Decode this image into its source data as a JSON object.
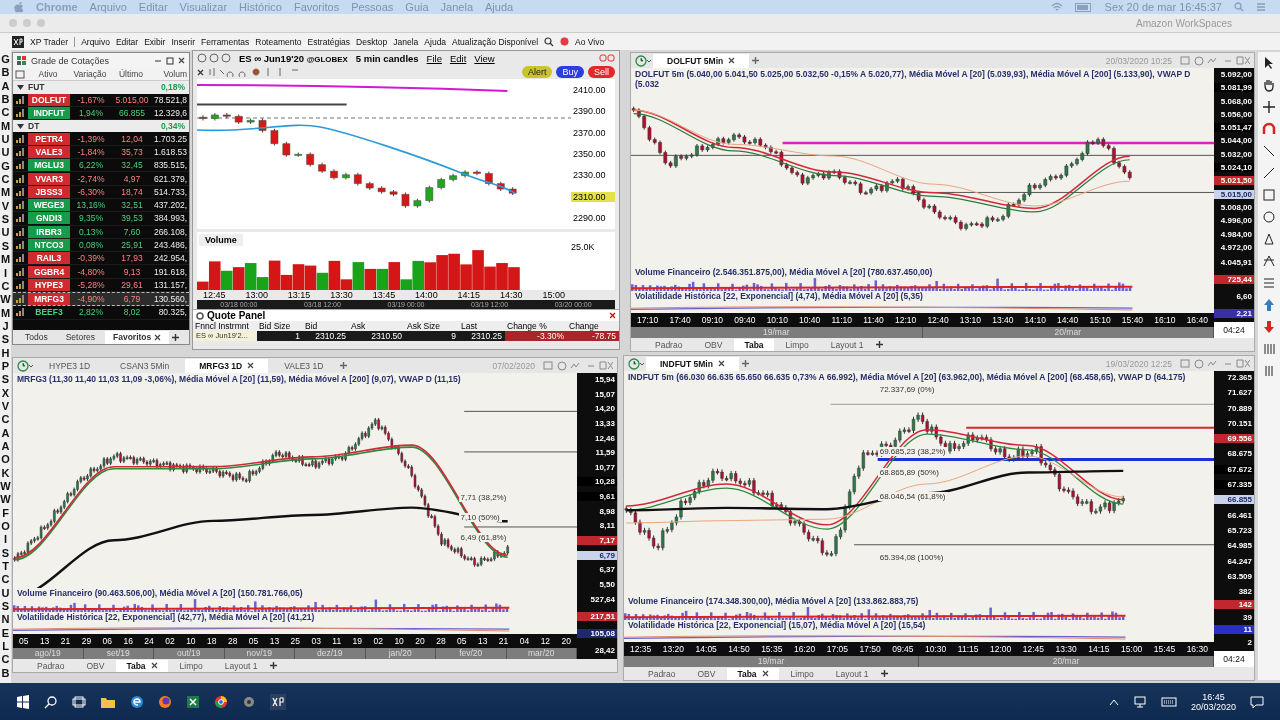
{
  "edge_letters": [
    "G",
    "B",
    "A",
    "B",
    "C",
    "M",
    "U",
    "U",
    "G",
    "C",
    "M",
    "V",
    "S",
    "U",
    "S",
    "M",
    "I",
    "C",
    "W",
    "M",
    "J",
    "S",
    "H",
    "P",
    "S",
    "X",
    "V",
    "C",
    "A",
    "A",
    "O",
    "K",
    "W",
    "W",
    "F",
    "O",
    "I",
    "S",
    "T",
    "C",
    "U",
    "S",
    "N",
    "E",
    "L",
    "C",
    "B"
  ],
  "mac_menubar": {
    "app": "Chrome",
    "menus": [
      "Arquivo",
      "Editar",
      "Visualizar",
      "Histórico",
      "Favoritos",
      "Pessoas",
      "Guia",
      "Janela",
      "Ajuda"
    ],
    "clock": "Sex 20 de mar  16:45:37"
  },
  "workspace_window": {
    "title": "Amazon WorkSpaces"
  },
  "xp_menubar": {
    "app": "XP Trader",
    "menus": [
      "Arquivo",
      "Editar",
      "Exibir",
      "Inserir",
      "Ferramentas",
      "Roteamento",
      "Estratégias",
      "Desktop",
      "Janela",
      "Ajuda",
      "Atualização Disponível"
    ],
    "live": "Ao Vivo"
  },
  "quote_grid": {
    "title": "Grade de Cotações",
    "columns": [
      "Ativo",
      "Variação",
      "Último",
      "Volum"
    ],
    "groups": [
      {
        "name": "FUT",
        "change": "0,18%",
        "expanded": true,
        "rows": [
          {
            "symbol": "DOLFUT",
            "change": "-1,67%",
            "last": "5.015,00",
            "volume": "78.521,8",
            "up": false,
            "badge": true,
            "selected": false
          },
          {
            "symbol": "INDFUT",
            "change": "1,94%",
            "last": "66.855",
            "volume": "12.329,6",
            "up": true,
            "badge": true,
            "selected": false
          }
        ]
      },
      {
        "name": "DT",
        "change": "0,34%",
        "expanded": true,
        "rows": [
          {
            "symbol": "PETR4",
            "change": "-1,39%",
            "last": "12,04",
            "volume": "1.703.25",
            "up": false,
            "badge": true,
            "selected": false
          },
          {
            "symbol": "VALE3",
            "change": "-1,84%",
            "last": "35,73",
            "volume": "1.618.53",
            "up": false,
            "badge": true,
            "selected": false
          },
          {
            "symbol": "MGLU3",
            "change": "6,22%",
            "last": "32,45",
            "volume": "835.515,",
            "up": true,
            "badge": true,
            "selected": false
          },
          {
            "symbol": "VVAR3",
            "change": "-2,74%",
            "last": "4,97",
            "volume": "621.379,",
            "up": false,
            "badge": true,
            "selected": false
          },
          {
            "symbol": "JBSS3",
            "change": "-6,30%",
            "last": "18,74",
            "volume": "514.733,",
            "up": false,
            "badge": true,
            "selected": false
          },
          {
            "symbol": "WEGE3",
            "change": "13,16%",
            "last": "32,51",
            "volume": "437.202,",
            "up": true,
            "badge": true,
            "selected": false
          },
          {
            "symbol": "GNDI3",
            "change": "9,35%",
            "last": "39,53",
            "volume": "384.993,",
            "up": true,
            "badge": true,
            "selected": false
          },
          {
            "symbol": "IRBR3",
            "change": "0,13%",
            "last": "7,60",
            "volume": "266.108,",
            "up": true,
            "badge": true,
            "selected": false
          },
          {
            "symbol": "NTCO3",
            "change": "0,08%",
            "last": "25,91",
            "volume": "243.486,",
            "up": true,
            "badge": true,
            "selected": false
          },
          {
            "symbol": "RAIL3",
            "change": "-0,39%",
            "last": "17,93",
            "volume": "242.954,",
            "up": false,
            "badge": true,
            "selected": false
          },
          {
            "symbol": "GGBR4",
            "change": "-4,80%",
            "last": "9,13",
            "volume": "191.618,",
            "up": false,
            "badge": true,
            "selected": false
          },
          {
            "symbol": "HYPE3",
            "change": "-5,28%",
            "last": "29,61",
            "volume": "131.157,",
            "up": false,
            "badge": true,
            "selected": false
          },
          {
            "symbol": "MRFG3",
            "change": "-4,90%",
            "last": "6,79",
            "volume": "130.560,",
            "up": false,
            "badge": true,
            "selected": true
          },
          {
            "symbol": "BEEF3",
            "change": "2,82%",
            "last": "8,02",
            "volume": "80.325,",
            "up": true,
            "badge": false,
            "selected": false
          }
        ]
      }
    ],
    "tabs": [
      {
        "label": "Todos",
        "selected": false,
        "closable": false
      },
      {
        "label": "Setores",
        "selected": false,
        "closable": false
      },
      {
        "label": "Favoritos",
        "selected": true,
        "closable": true
      }
    ]
  },
  "es_chart": {
    "symbol": "ES ∞ Jun19'20",
    "exchange": "@GLOBEX",
    "interval": "5 min candles",
    "menus": [
      "File",
      "Edit",
      "View"
    ],
    "buttons": [
      {
        "label": "Alert",
        "kind": "alert"
      },
      {
        "label": "Buy",
        "kind": "buy"
      },
      {
        "label": "Sell",
        "kind": "sell"
      }
    ],
    "price_axis": [
      {
        "label": "2410.00"
      },
      {
        "label": "2390.00"
      },
      {
        "label": "2370.00"
      },
      {
        "label": "2350.00"
      },
      {
        "label": "2330.00"
      },
      {
        "label": "2310.00",
        "color": "#e4e24a"
      },
      {
        "label": "2290.00"
      }
    ],
    "volume_title": "Volume",
    "volume_axis": "25.0K",
    "time_axis": [
      "12:45",
      "13:00",
      "13:15",
      "13:30",
      "13:45",
      "14:00",
      "14:15",
      "14:30",
      "15:00"
    ],
    "scroll_dates": [
      "03/18 00:00",
      "03/18 12:00",
      "03/19 00:00",
      "03/19 12:00",
      "03/20 00:00"
    ]
  },
  "quote_panel": {
    "title": "Quote Panel",
    "columns": [
      "Fnncl Instrmnt",
      "Bid Size",
      "Bid",
      "Ask",
      "Ask Size",
      "Last",
      "Change %",
      "Change"
    ],
    "row": [
      "ES ∞ Jun19'2...",
      "1",
      "2310.25",
      "2310.50",
      "9",
      "2310.25",
      "-3.30%",
      "-78.75"
    ]
  },
  "charts": [
    {
      "tabs": [
        {
          "label": "DOLFUT 5Min",
          "selected": true,
          "closable": true
        }
      ],
      "date": "20/03/2020 10:25",
      "legend": "DOLFUT 5m (5.040,00  5.041,50  5.025,00  5.032,50  -0,15%  A 5.020,77), Média Móvel A [20] (5.039,93), Média Móvel A [200] (5.133,90), VWAP D (5.032",
      "axis": [
        {
          "label": "5.092,00"
        },
        {
          "label": "5.081,99",
          "color": "#000000"
        },
        {
          "label": "5.068,00"
        },
        {
          "label": "5.056,00"
        },
        {
          "label": "5.051,47",
          "color": "#000000"
        },
        {
          "label": "5.044,00"
        },
        {
          "label": "5.032,00"
        },
        {
          "label": "5.024,10",
          "color": "#000000"
        },
        {
          "label": "5.021,50",
          "color": "#c0282d"
        },
        {
          "label": "5.015,00",
          "color": "#c9d3ea"
        },
        {
          "label": "5.008,00"
        },
        {
          "label": "4.996,00"
        },
        {
          "label": "4.984,00"
        },
        {
          "label": "4.972,00"
        }
      ],
      "lower_axis": [
        {
          "label": "4.045,91"
        },
        {
          "label": "725,44",
          "color": "#c0282d"
        },
        {
          "label": "6,60"
        },
        {
          "label": "2,21",
          "color": "#3a2fa8"
        }
      ],
      "volume_legend": "Volume Financeiro (2.546.351.875,00), Média Móvel A [20] (780.637.450,00)",
      "volatility_legend": "Volatilidade Histórica [22, Exponencial] (4,74), Média Móvel A [20] (5,35)",
      "time_axis": [
        "17:10",
        "17:40",
        "09:10",
        "09:40",
        "10:10",
        "10:40",
        "11:10",
        "11:40",
        "12:10",
        "12:40",
        "13:10",
        "13:40",
        "14:10",
        "14:40",
        "15:10",
        "15:40",
        "16:10",
        "16:40"
      ],
      "date_band": [
        "19/mar",
        "20/mar"
      ],
      "clock": "04:24",
      "bottom_tabs": [
        {
          "label": "Padrao",
          "selected": false,
          "closable": false
        },
        {
          "label": "OBV",
          "selected": false,
          "closable": false
        },
        {
          "label": "Taba",
          "selected": true,
          "closable": false
        },
        {
          "label": "Limpo",
          "selected": false,
          "closable": false
        },
        {
          "label": "Layout 1",
          "selected": false,
          "closable": false
        }
      ]
    },
    {
      "tabs": [
        {
          "label": "HYPE3 1D",
          "selected": false,
          "closable": false
        },
        {
          "label": "CSAN3 5Min",
          "selected": false,
          "closable": false
        },
        {
          "label": "MRFG3 1D",
          "selected": true,
          "closable": true
        },
        {
          "label": "VALE3 1D",
          "selected": false,
          "closable": false
        }
      ],
      "date": "07/02/2020",
      "legend": "MRFG3 (11,30  11,40  11,03  11,09  -3,06%), Média Móvel A [20] (11,59), Média Móvel A [200] (9,07), VWAP D (11,15)",
      "fib_levels": [
        "7,71 (38,2%)",
        "7,10 (50%)",
        "6,49 (61,8%)"
      ],
      "axis": [
        {
          "label": "15,94"
        },
        {
          "label": "15,07"
        },
        {
          "label": "14,20"
        },
        {
          "label": "13,33"
        },
        {
          "label": "12,46"
        },
        {
          "label": "11,59"
        },
        {
          "label": "10,77"
        },
        {
          "label": "10,28",
          "color": "#000000"
        },
        {
          "label": "9,61",
          "color": "#000000"
        },
        {
          "label": "8,98"
        },
        {
          "label": "8,11"
        },
        {
          "label": "7,17",
          "color": "#c0282d"
        },
        {
          "label": "6,79",
          "color": "#c9d3ea"
        },
        {
          "label": "6,37"
        },
        {
          "label": "5,50"
        }
      ],
      "lower_axis": [
        {
          "label": "527,64"
        },
        {
          "label": "217,51",
          "color": "#c0282d"
        },
        {
          "label": "105,08",
          "color": "#1f2a6a"
        },
        {
          "label": "28,42"
        }
      ],
      "volume_legend": "Volume Financeiro (90.463.506,00), Média Móvel A [20] (150.781.766,05)",
      "volatility_legend": "Volatilidade Histórica [22, Exponencial] (42,77), Média Móvel A [20] (41,21)",
      "time_axis": [
        "05",
        "13",
        "21",
        "29",
        "06",
        "16",
        "24",
        "02",
        "10",
        "18",
        "28",
        "05",
        "13",
        "25",
        "03",
        "11",
        "19",
        "02",
        "10",
        "20",
        "28",
        "05",
        "13",
        "21",
        "04",
        "12",
        "20"
      ],
      "date_band": [
        "ago/19",
        "set/19",
        "out/19",
        "nov/19",
        "dez/19",
        "jan/20",
        "fev/20",
        "mar/20"
      ],
      "bottom_tabs": [
        {
          "label": "Padrao",
          "selected": false,
          "closable": false
        },
        {
          "label": "OBV",
          "selected": false,
          "closable": false
        },
        {
          "label": "Taba",
          "selected": true,
          "closable": true
        },
        {
          "label": "Limpo",
          "selected": false,
          "closable": false
        },
        {
          "label": "Layout 1",
          "selected": false,
          "closable": false
        }
      ]
    },
    {
      "tabs": [
        {
          "label": "INDFUT 5Min",
          "selected": true,
          "closable": true
        }
      ],
      "date": "19/03/2020 12:25",
      "legend": "INDFUT 5m (66.030  66.635  65.650  66.635  0,73%  A 66.992), Média Móvel A [20] (63.962,00), Média Móvel A [200] (68.458,65), VWAP D (64.175)",
      "fib_levels": [
        "72.337,69 (0%)",
        "69.685,23 (38,2%)",
        "68.865,89 (50%)",
        "68.046,54 (61,8%)",
        "65.394,08 (100%)"
      ],
      "axis": [
        {
          "label": "72.365"
        },
        {
          "label": "71.627"
        },
        {
          "label": "70.889"
        },
        {
          "label": "70.151"
        },
        {
          "label": "69.556",
          "color": "#c0282d"
        },
        {
          "label": "68.675"
        },
        {
          "label": "67.672",
          "color": "#000000"
        },
        {
          "label": "67.335",
          "color": "#000000"
        },
        {
          "label": "66.855",
          "color": "#c9d3ea"
        },
        {
          "label": "66.461"
        },
        {
          "label": "65.723"
        },
        {
          "label": "64.985"
        },
        {
          "label": "64.247"
        },
        {
          "label": "63.509"
        }
      ],
      "lower_axis": [
        {
          "label": "382"
        },
        {
          "label": "142",
          "color": "#c0282d"
        },
        {
          "label": "39"
        },
        {
          "label": "11",
          "color": "#2a2fc0"
        },
        {
          "label": "2"
        }
      ],
      "volume_legend": "Volume Financeiro (174.348.300,00), Média Móvel A [20] (133.862.883,75)",
      "volatility_legend": "Volatilidade Histórica [22, Exponencial] (15,07), Média Móvel A [20] (15,54)",
      "time_axis": [
        "12:35",
        "13:20",
        "14:05",
        "14:50",
        "15:35",
        "16:20",
        "17:05",
        "17:50",
        "09:45",
        "10:30",
        "11:15",
        "12:00",
        "12:45",
        "13:30",
        "14:15",
        "15:00",
        "15:45",
        "16:30"
      ],
      "date_band": [
        "19/mar",
        "20/mar"
      ],
      "clock": "04:24",
      "bottom_tabs": [
        {
          "label": "Padrao",
          "selected": false,
          "closable": false
        },
        {
          "label": "OBV",
          "selected": false,
          "closable": false
        },
        {
          "label": "Taba",
          "selected": true,
          "closable": true
        },
        {
          "label": "Limpo",
          "selected": false,
          "closable": false
        },
        {
          "label": "Layout 1",
          "selected": false,
          "closable": false
        }
      ]
    }
  ],
  "taskbar": {
    "time": "16:45",
    "date": "20/03/2020"
  }
}
